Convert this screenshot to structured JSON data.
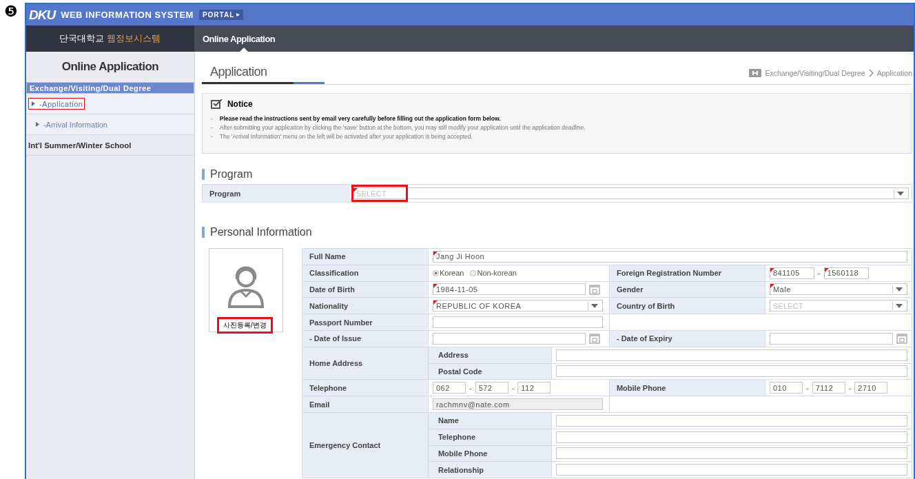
{
  "step_marker": "❺",
  "header": {
    "logo": "DKU",
    "title": "WEB INFORMATION SYSTEM",
    "portal_button": "PORTAL"
  },
  "navbar": {
    "school": "단국대학교",
    "system": "웹정보시스템",
    "tabs": [
      {
        "label": "Online Application",
        "selected": true
      }
    ]
  },
  "sidebar": {
    "title": "Online Application",
    "items": [
      {
        "label": "Exchange/Visiting/Dual Degree",
        "selected": true,
        "children": [
          {
            "label": "-Application",
            "selected": true,
            "highlighted": true
          },
          {
            "label": "-Arrival Information",
            "selected": false,
            "highlighted": false
          }
        ]
      },
      {
        "label": "Int'l Summer/Winter School",
        "selected": false
      }
    ]
  },
  "page": {
    "title": "Application",
    "breadcrumb": [
      "Exchange/Visiting/Dual Degree",
      "Application"
    ]
  },
  "notice": {
    "title": "Notice",
    "items": [
      {
        "marker": "-",
        "text": "Please read the instructions sent by email very carefully before filling out the application form below.",
        "emphasis": true
      },
      {
        "marker": "-",
        "text": "After submitting your application by clicking the 'save' button at the bottom, you may still modify your application until the application deadline.",
        "emphasis": false
      },
      {
        "marker": "-",
        "text": "The 'Arrival Information' menu on the left will be activated after your application is being accepted.",
        "emphasis": false
      }
    ]
  },
  "program": {
    "heading": "Program",
    "label": "Program",
    "placeholder": "SELECT",
    "required": true,
    "highlighted": true
  },
  "personal_information": {
    "heading": "Personal Information",
    "photo": {
      "button": "사진등록/변경",
      "highlighted": true
    },
    "full_name": {
      "label": "Full Name",
      "value": "Jang Ji Hoon",
      "required": true
    },
    "classification": {
      "label": "Classification",
      "options": [
        {
          "label": "Korean",
          "selected": true
        },
        {
          "label": "Non-korean",
          "selected": false
        }
      ]
    },
    "foreign_registration_number": {
      "label": "Foreign Registration Number",
      "separator": "-",
      "parts": [
        {
          "value": "841105",
          "required": true
        },
        {
          "value": "1560118",
          "required": true
        }
      ]
    },
    "date_of_birth": {
      "label": "Date of Birth",
      "value": "1984-11-05",
      "required": true
    },
    "gender": {
      "label": "Gender",
      "value": "Male",
      "required": true
    },
    "nationality": {
      "label": "Nationality",
      "value": "REPUBLIC OF KOREA",
      "required": true
    },
    "country_of_birth": {
      "label": "Country of Birth",
      "placeholder": "SELECT"
    },
    "passport_number": {
      "label": "Passport Number"
    },
    "date_of_issue": {
      "label": "- Date of Issue"
    },
    "date_of_expiry": {
      "label": "- Date of Expiry"
    },
    "home_address": {
      "label": "Home Address",
      "fields": [
        {
          "label": "Address"
        },
        {
          "label": "Postal Code"
        }
      ]
    },
    "telephone": {
      "label": "Telephone",
      "parts": [
        {
          "value": "062"
        },
        {
          "separator": "-",
          "value": "572"
        },
        {
          "separator": "-",
          "value": "112"
        }
      ]
    },
    "mobile_phone": {
      "label": "Mobile Phone",
      "parts": [
        {
          "value": "010"
        },
        {
          "separator": "-",
          "value": "7112"
        },
        {
          "separator": "-",
          "value": "2710"
        }
      ]
    },
    "email": {
      "label": "Email",
      "value": "rachmnv@nate.com",
      "disabled": true
    },
    "emergency_contact": {
      "label": "Emergency Contact",
      "fields": [
        {
          "label": "Name"
        },
        {
          "label": "Telephone"
        },
        {
          "label": "Mobile Phone"
        },
        {
          "label": "Relationship"
        }
      ]
    }
  }
}
